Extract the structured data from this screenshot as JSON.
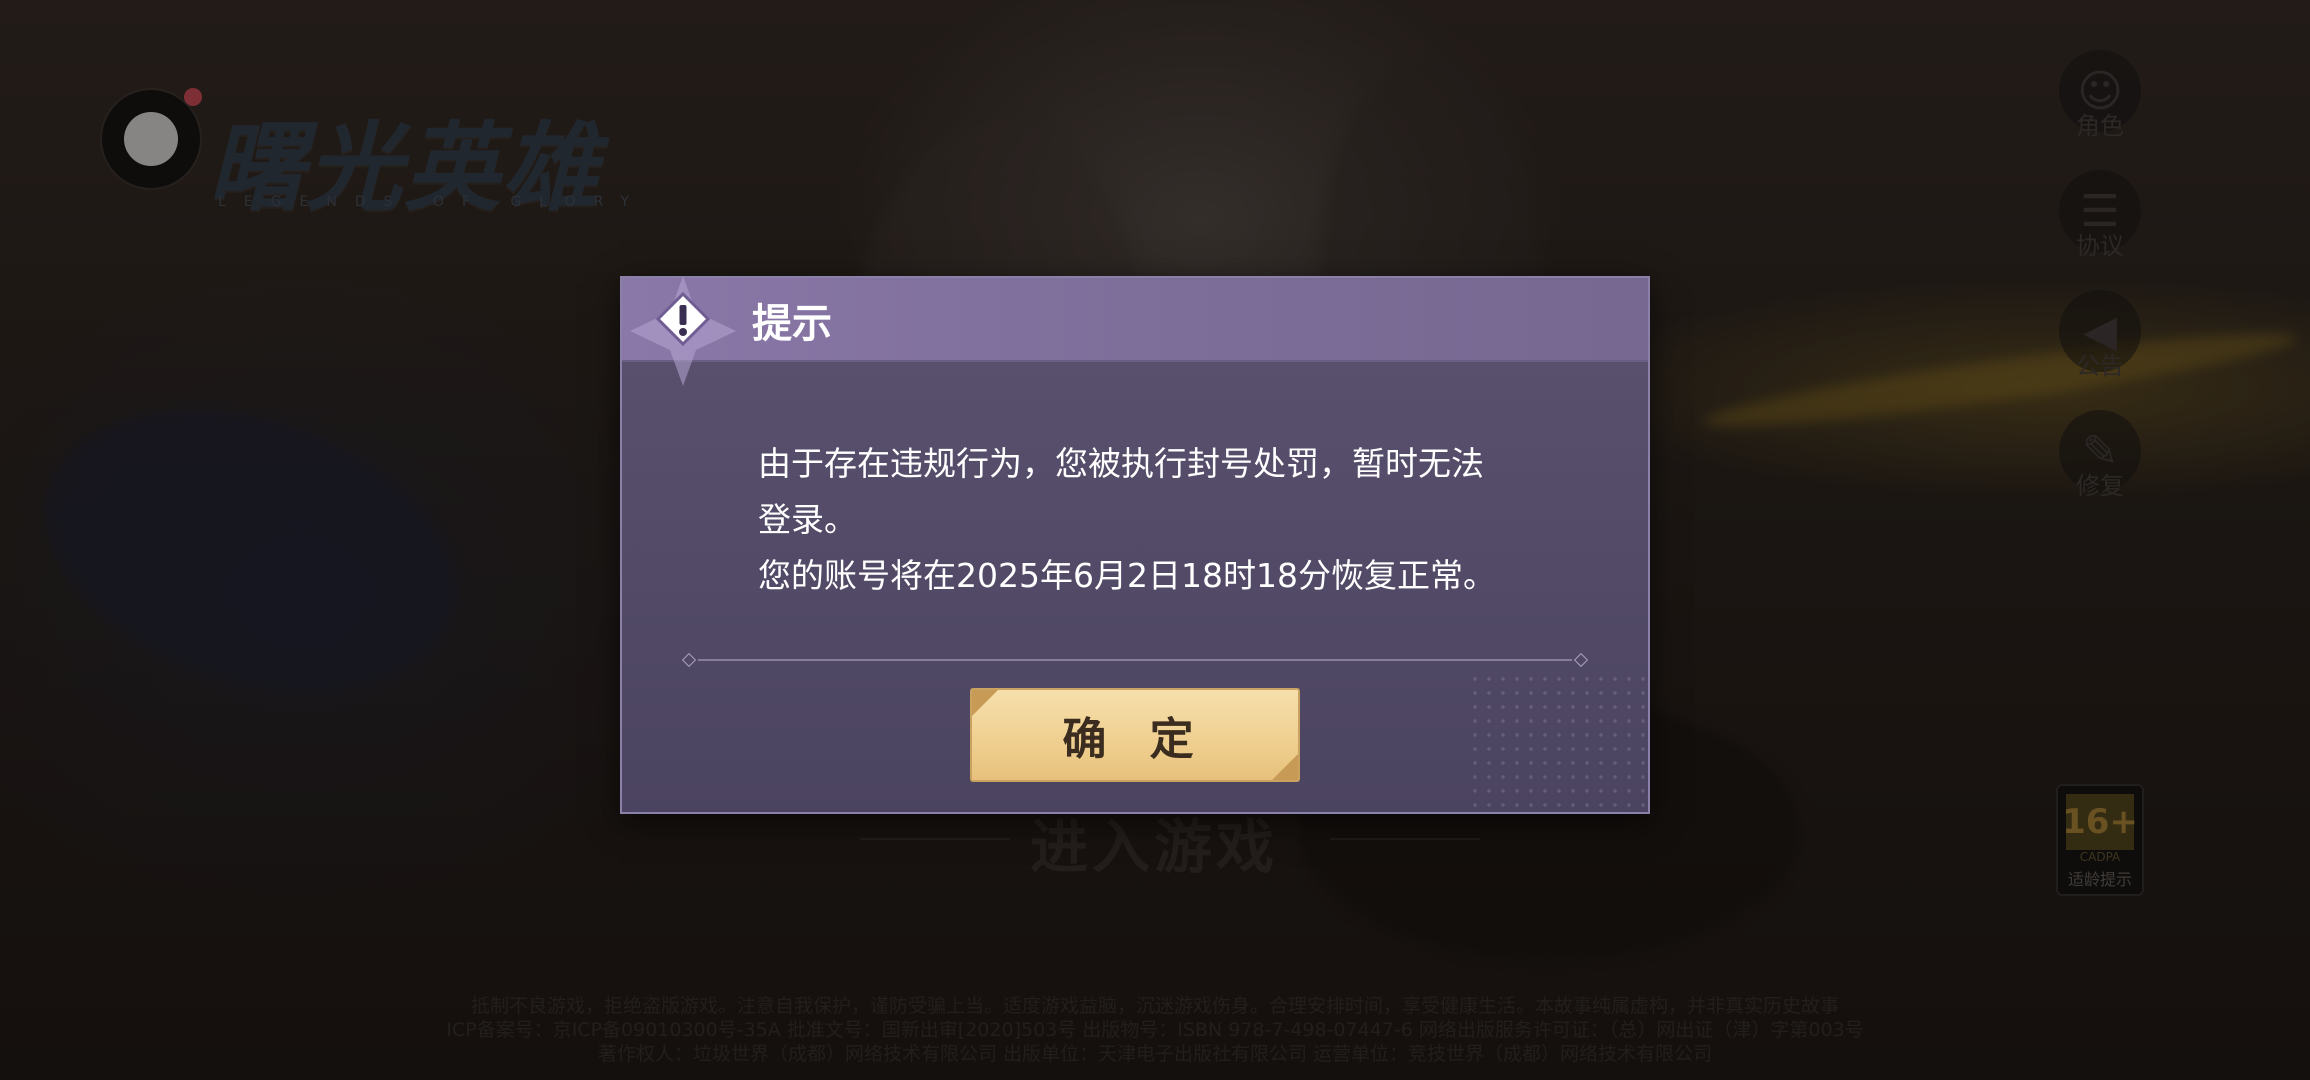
{
  "logo": {
    "title": "曙光英雄",
    "subtitle": "LEGENDS OF GLORY"
  },
  "side_menu": [
    {
      "label": "角色",
      "icon": "character-icon"
    },
    {
      "label": "协议",
      "icon": "agreement-icon"
    },
    {
      "label": "公告",
      "icon": "megaphone-icon"
    },
    {
      "label": "修复",
      "icon": "wrench-icon"
    }
  ],
  "age_badge": {
    "number": "16+",
    "org": "CADPA",
    "label": "适龄提示"
  },
  "enter_game": "进入游戏",
  "footer": {
    "line1": "抵制不良游戏，拒绝盗版游戏。注意自我保护，谨防受骗上当。适度游戏益脑，沉迷游戏伤身。合理安排时间，享受健康生活。本故事纯属虚构，并非真实历史故事",
    "line2": "ICP备案号：京ICP备09010300号-35A  批准文号：国新出审[2020]503号  出版物号：ISBN 978-7-498-07447-6  网络出版服务许可证：（总）网出证（津）字第003号",
    "line3": "著作权人：垃圾世界（成都）网络技术有限公司  出版单位：天津电子出版社有限公司  运营单位：竞技世界（成都）网络技术有限公司"
  },
  "dialog": {
    "title": "提示",
    "message_line1": "由于存在违规行为，您被执行封号处罚，暂时无法",
    "message_line2": "登录。",
    "message_line3": "您的账号将在2025年6月2日18时18分恢复正常。",
    "confirm_label": "确 定"
  },
  "colors": {
    "dialog_bg": "#524a66",
    "dialog_header": "#8a78a8",
    "button_gold": "#efcf8f",
    "text_white": "#ffffff"
  }
}
